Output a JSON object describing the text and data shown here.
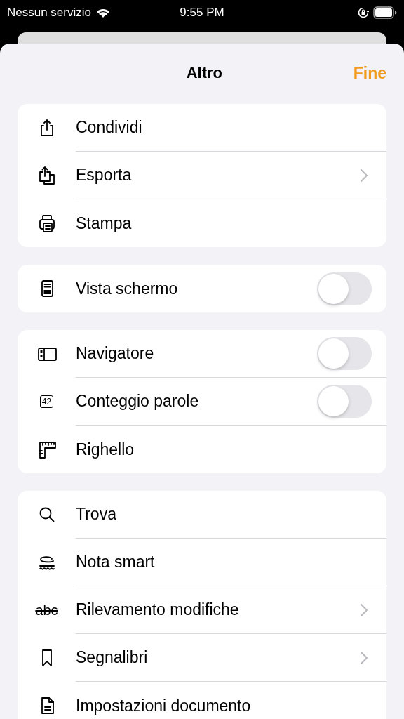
{
  "status_bar": {
    "carrier": "Nessun servizio",
    "time": "9:55 PM"
  },
  "header": {
    "title": "Altro",
    "done": "Fine"
  },
  "groups": [
    {
      "rows": [
        {
          "label": "Condividi",
          "kind": "plain"
        },
        {
          "label": "Esporta",
          "kind": "chevron"
        },
        {
          "label": "Stampa",
          "kind": "plain"
        }
      ]
    },
    {
      "rows": [
        {
          "label": "Vista schermo",
          "kind": "toggle",
          "on": false
        }
      ]
    },
    {
      "rows": [
        {
          "label": "Navigatore",
          "kind": "toggle",
          "on": false
        },
        {
          "icon_text": "42",
          "label": "Conteggio parole",
          "kind": "toggle",
          "on": false
        },
        {
          "label": "Righello",
          "kind": "plain"
        }
      ]
    },
    {
      "rows": [
        {
          "label": "Trova",
          "kind": "plain"
        },
        {
          "label": "Nota smart",
          "kind": "plain"
        },
        {
          "icon_text": "abc",
          "label": "Rilevamento modifiche",
          "kind": "chevron"
        },
        {
          "label": "Segnalibri",
          "kind": "chevron"
        },
        {
          "label": "Impostazioni documento",
          "kind": "plain"
        }
      ]
    }
  ]
}
